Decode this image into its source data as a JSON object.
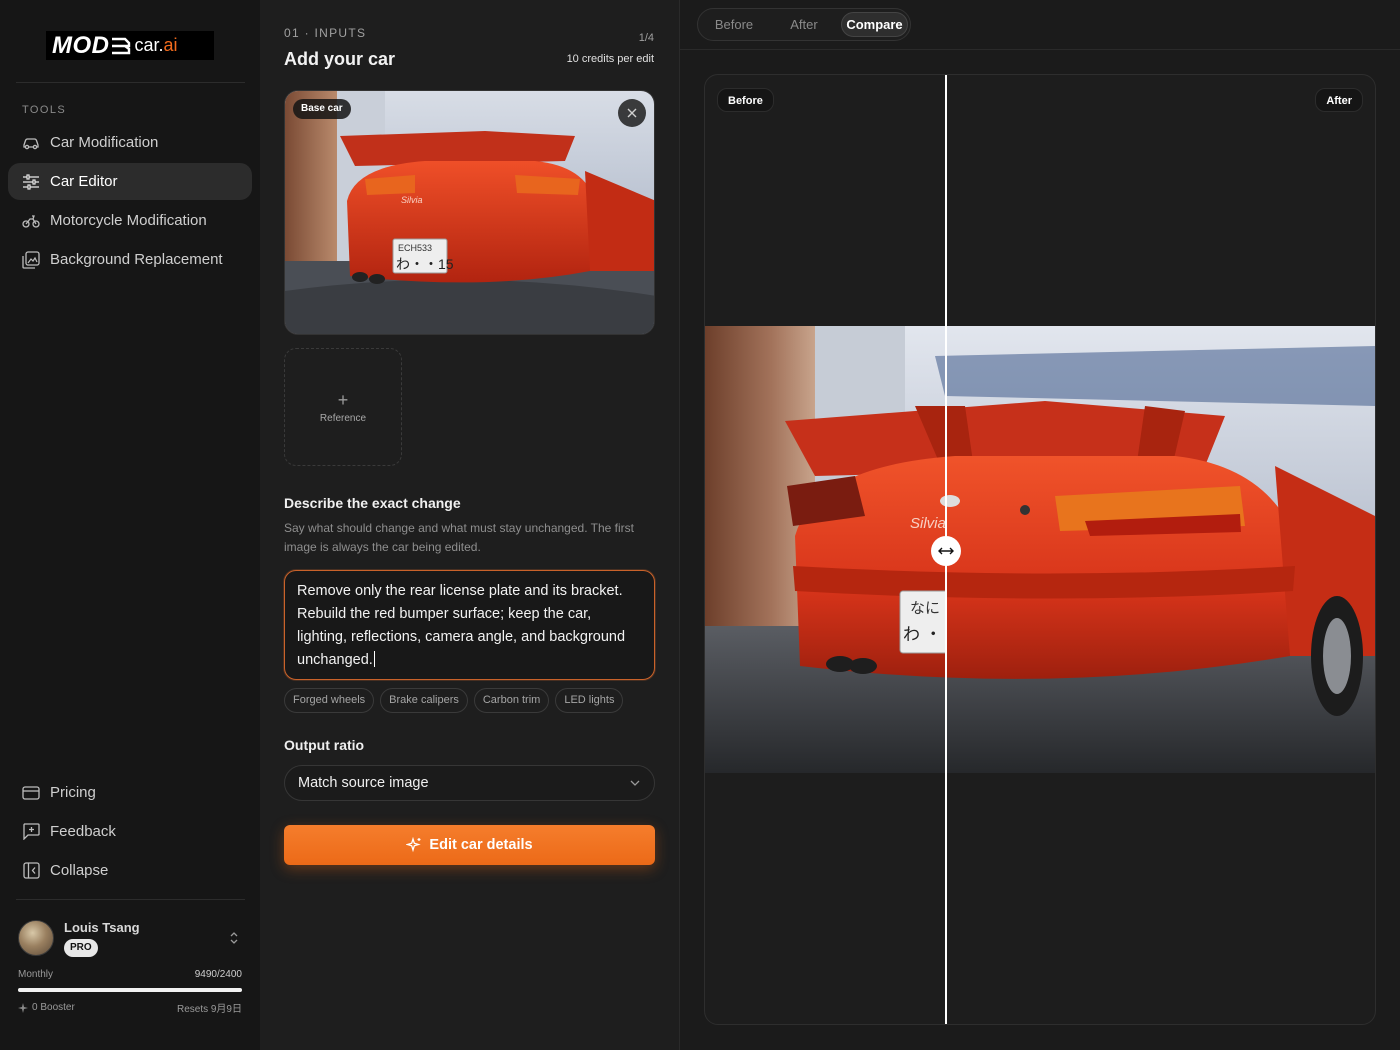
{
  "brand": {
    "logo_mod": "MOD",
    "logo_car": "car.",
    "logo_ai": "ai"
  },
  "sidebar": {
    "section_label": "TOOLS",
    "items": [
      {
        "label": "Car Modification",
        "icon": "car-icon",
        "active": false
      },
      {
        "label": "Car Editor",
        "icon": "sliders-icon",
        "active": true
      },
      {
        "label": "Motorcycle Modification",
        "icon": "motorcycle-icon",
        "active": false
      },
      {
        "label": "Background Replacement",
        "icon": "image-replace-icon",
        "active": false
      }
    ],
    "bottom_items": [
      {
        "label": "Pricing",
        "icon": "card-icon"
      },
      {
        "label": "Feedback",
        "icon": "feedback-icon"
      },
      {
        "label": "Collapse",
        "icon": "collapse-icon"
      }
    ],
    "user": {
      "name": "Louis Tsang",
      "plan": "PRO",
      "usage_label": "Monthly",
      "usage_value": "9490/2400",
      "usage_fill": 1.0,
      "booster": "0 Booster",
      "resets": "Resets 9月9日"
    }
  },
  "inputs": {
    "step_label": "01 · INPUTS",
    "step_count": "1/4",
    "title": "Add your car",
    "credits": "10 credits per edit",
    "base_tag": "Base car",
    "reference_label": "Reference",
    "reference_plus": "+",
    "describe_title": "Describe the exact change",
    "describe_help": "Say what should change and what must stay unchanged. The first image is always the car being edited.",
    "prompt_value": "Remove only the rear license plate and its bracket. Rebuild the red bumper surface; keep the car, lighting, reflections, camera angle, and background unchanged.",
    "chips": [
      "Forged wheels",
      "Brake calipers",
      "Carbon trim",
      "LED lights"
    ],
    "ratio_title": "Output ratio",
    "ratio_value": "Match source image",
    "cta_label": "Edit car details"
  },
  "preview": {
    "tabs": [
      {
        "label": "Before",
        "active": false
      },
      {
        "label": "After",
        "active": false
      },
      {
        "label": "Compare",
        "active": true
      }
    ],
    "before_tag": "Before",
    "after_tag": "After",
    "plate_text_top": "なに",
    "plate_text_bottom": "わ ・",
    "thumb_plate_top": "ECH533",
    "thumb_plate_bottom": "わ・・15",
    "badge_text": "Silvia"
  },
  "colors": {
    "accent": "#f26b1d",
    "car_red": "#d7341a",
    "bg": "#1a1a1a"
  }
}
